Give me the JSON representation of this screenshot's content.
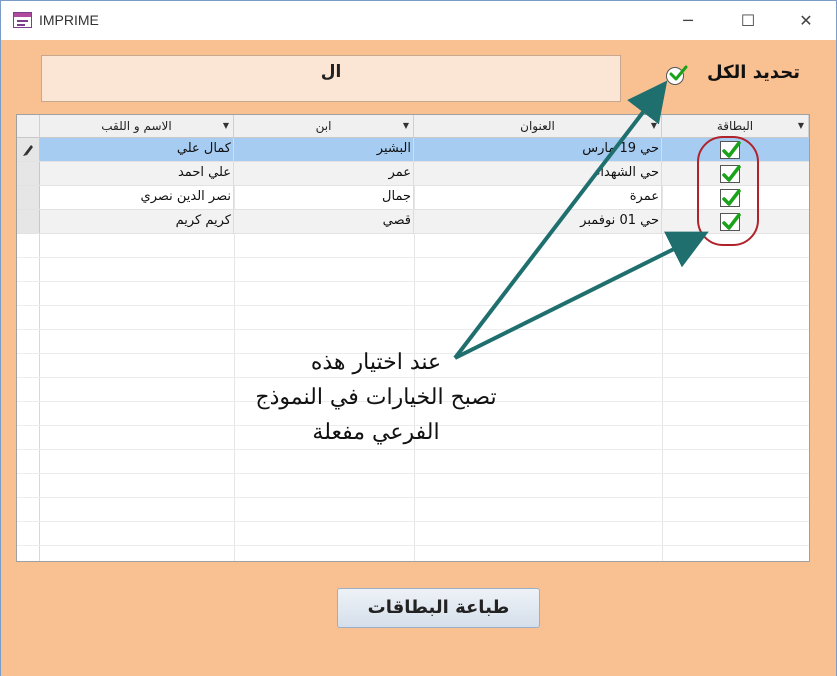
{
  "window": {
    "title": "IMPRIME",
    "minimize": "─",
    "maximize": "☐",
    "close": "✕"
  },
  "header": {
    "text": "ال"
  },
  "select_all": {
    "label": "تحديد الكل",
    "checked": true
  },
  "grid": {
    "columns": [
      {
        "label": "الاسم و اللقب"
      },
      {
        "label": "ابن"
      },
      {
        "label": "العنوان"
      },
      {
        "label": "البطاقة"
      }
    ],
    "rows": [
      {
        "name": "كمال علي",
        "son_of": "البشير",
        "address": "حي 19 مارس",
        "card": true
      },
      {
        "name": "علي احمد",
        "son_of": "عمر",
        "address": "حي الشهداء",
        "card": true
      },
      {
        "name": "نصر الدين نصري",
        "son_of": "جمال",
        "address": "عمرة",
        "card": true
      },
      {
        "name": "كريم كريم",
        "son_of": "قصي",
        "address": "حي 01 نوفمبر",
        "card": true
      }
    ]
  },
  "annotation": {
    "line1": "عند اختيار هذه",
    "line2": "تصبح الخيارات في النموذج",
    "line3": "الفرعي مفعلة"
  },
  "print_button": {
    "label": "طباعة البطاقات"
  },
  "colors": {
    "background": "#f9c091",
    "header_box": "#fbe5d5",
    "selected_row": "#a6ccf2",
    "check": "#1aa31a",
    "arrow": "#1f6f6f",
    "oval": "#b0232a"
  }
}
